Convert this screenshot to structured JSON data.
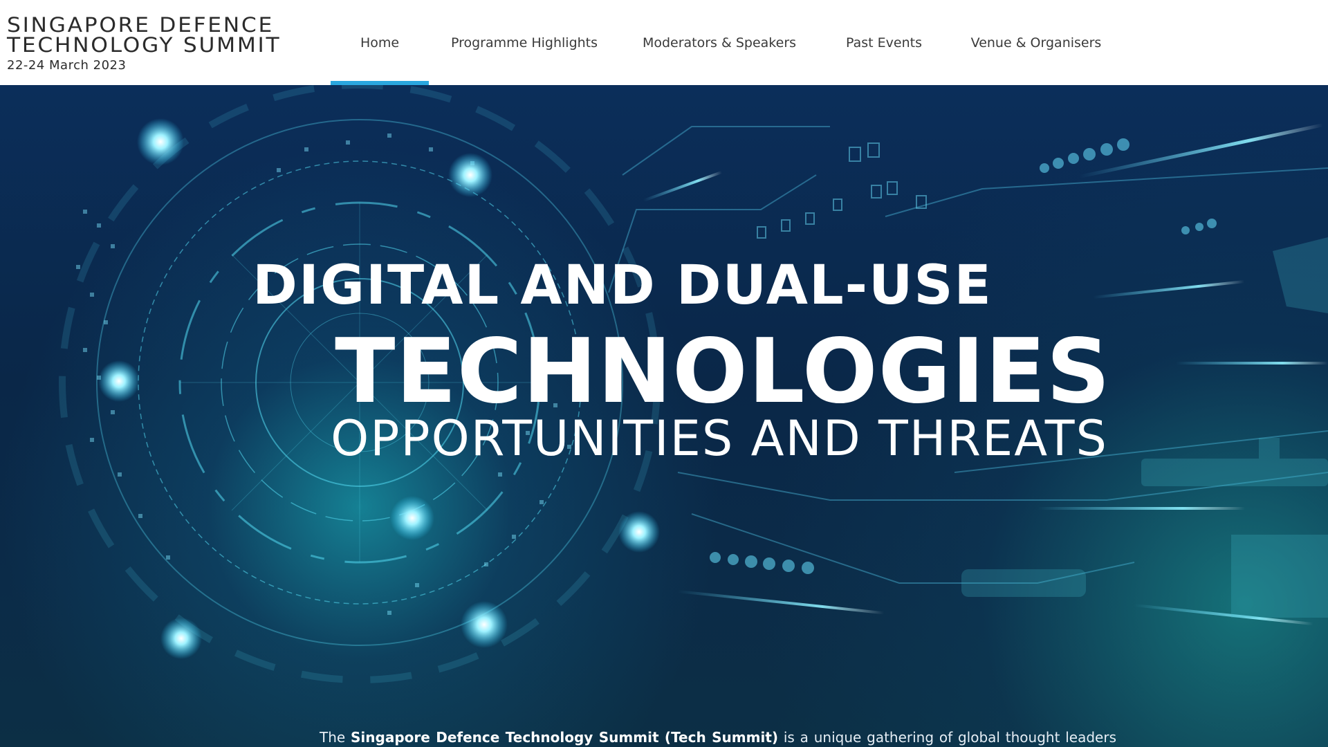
{
  "logo": {
    "line1": "SINGAPORE DEFENCE",
    "line2": "TECHNOLOGY SUMMIT",
    "date": "22-24 March 2023"
  },
  "nav": {
    "items": [
      {
        "label": "Home",
        "active": true
      },
      {
        "label": "Programme Highlights"
      },
      {
        "label": "Moderators & Speakers"
      },
      {
        "label": "Past Events"
      },
      {
        "label": "Venue & Organisers"
      }
    ]
  },
  "hero": {
    "line1": "DIGITAL AND DUAL-USE",
    "line2": "TECHNOLOGIES",
    "line3": "OPPORTUNITIES AND THREATS"
  },
  "intro": {
    "prefix": "The",
    "bold": "Singapore Defence Technology Summit (Tech Summit)",
    "rest": "is a unique gathering of global thought leaders from government, industry, academia, and think tanks, to network, confer, and collaborate in the development of defence and"
  },
  "colors": {
    "accent": "#2aa7df",
    "hero_bg": "#0a2748",
    "glow": "#4fe3ff"
  }
}
